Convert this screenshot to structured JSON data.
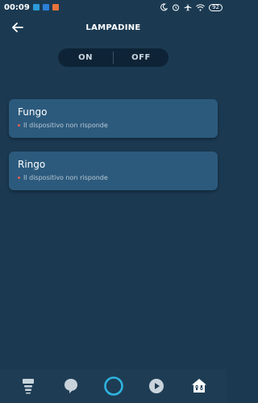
{
  "status_bar": {
    "time": "00:09",
    "battery": "92",
    "icons": [
      "moon-icon",
      "alarm-icon",
      "airplane-icon",
      "wifi-icon",
      "battery-icon"
    ],
    "notification_colors": [
      "#2d9ad8",
      "#2d7fd8",
      "#e8743b"
    ]
  },
  "header": {
    "title": "LAMPADINE",
    "back_icon": "arrow-left-icon"
  },
  "toggle": {
    "on_label": "ON",
    "off_label": "OFF"
  },
  "devices": [
    {
      "name": "Fungo",
      "status": "Il dispositivo non risponde"
    },
    {
      "name": "Ringo",
      "status": "Il dispositivo non risponde"
    }
  ],
  "bottom_nav": {
    "items": [
      "home-icon",
      "chat-icon",
      "alexa-icon",
      "play-icon",
      "devices-icon"
    ],
    "accent": "#2fb4e0"
  },
  "colors": {
    "background": "#1b3a52",
    "card": "#2c5a7d",
    "status_dot": "#e2604d"
  }
}
